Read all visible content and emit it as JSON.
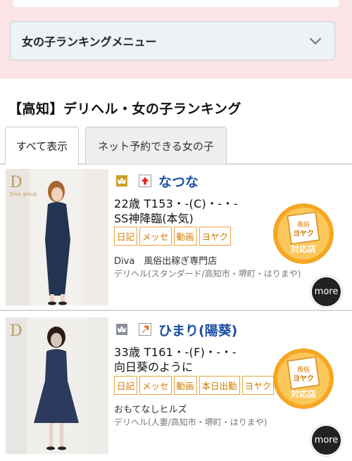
{
  "menu": {
    "label": "女の子ランキングメニュー",
    "chevron_icon": "chevron-down-icon"
  },
  "section": {
    "title": "【高知】デリヘル・女の子ランキング"
  },
  "tabs": [
    {
      "label": "すべて表示",
      "active": true
    },
    {
      "label": "ネット予約できる女の子",
      "active": false
    }
  ],
  "cards": [
    {
      "rank": "1",
      "rank_color": "#c9a227",
      "trend": "up",
      "trend_color": "#e52520",
      "name": "なつな",
      "stats": "22歳  T153・-(C)・-・-",
      "catch": "SS神降臨(本気)",
      "tags": [
        "日記",
        "メッセ",
        "動画",
        "ヨヤク"
      ],
      "shop": "Diva　風俗出稼ぎ専門店",
      "shop_type": "デリヘル(スタンダード/高知市・堺町・はりまや)",
      "badge_top": "ヨヤク",
      "badge_bottom": "対応店",
      "badge_icon": "yoyaku-badge-icon",
      "more": "more"
    },
    {
      "rank": "2",
      "rank_color": "#8a8f99",
      "trend": "up-right",
      "trend_color": "#e06a1b",
      "name": "ひまり(陽葵)",
      "stats": "33歳  T161・-(F)・-・-",
      "catch": "向日葵のように",
      "tags": [
        "日記",
        "メッセ",
        "動画",
        "本日出勤",
        "ヨヤク"
      ],
      "shop": "おもてなしヒルズ",
      "shop_type": "デリヘル(人妻/高知市・堺町・はりまや)",
      "badge_top": "ヨヤク",
      "badge_bottom": "対応店",
      "badge_icon": "yoyaku-badge-icon",
      "more": "more"
    }
  ]
}
